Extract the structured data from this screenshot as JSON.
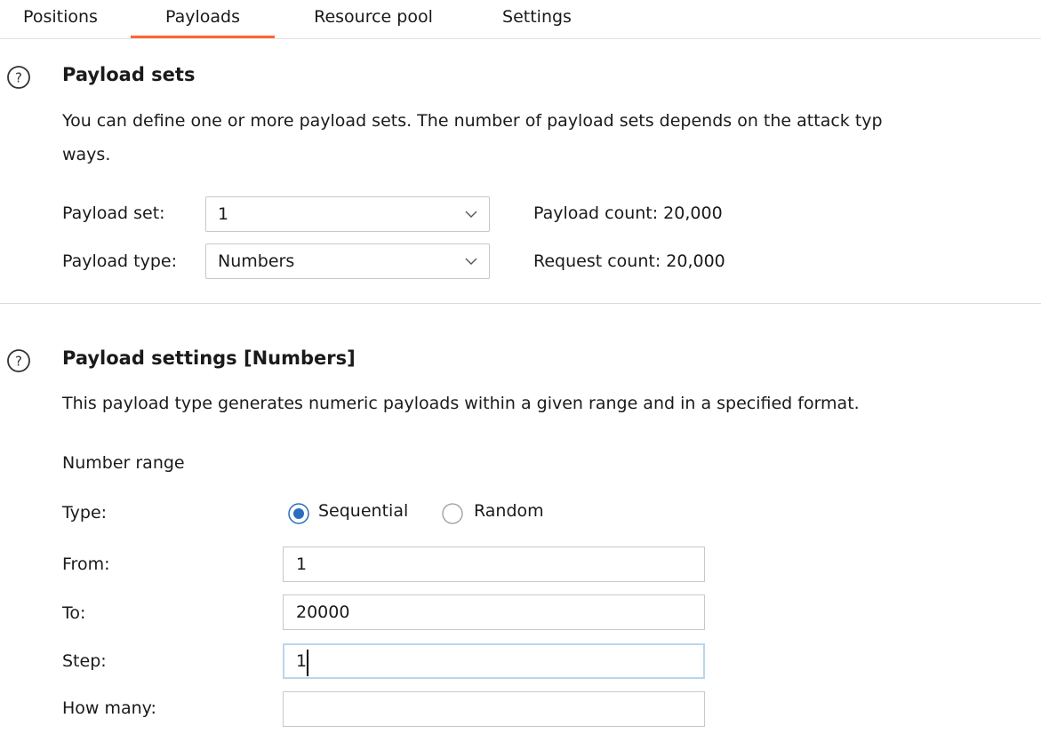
{
  "tabs": [
    {
      "label": "Positions"
    },
    {
      "label": "Payloads"
    },
    {
      "label": "Resource pool"
    },
    {
      "label": "Settings"
    }
  ],
  "active_tab": "Payloads",
  "accent_color": "#ff6633",
  "payload_sets": {
    "title": "Payload sets",
    "description_line1": "You can define one or more payload sets. The number of payload sets depends on the attack typ",
    "description_line2": "ways.",
    "set_label": "Payload set:",
    "set_value": "1",
    "type_label": "Payload type:",
    "type_value": "Numbers",
    "payload_count": "Payload count: 20,000",
    "request_count": "Request count: 20,000"
  },
  "payload_settings": {
    "title": "Payload settings [Numbers]",
    "description": "This payload type generates numeric payloads within a given range and in a specified format.",
    "number_range_heading": "Number range",
    "type_label": "Type:",
    "type_options": [
      {
        "label": "Sequential",
        "selected": true
      },
      {
        "label": "Random",
        "selected": false
      }
    ],
    "from_label": "From:",
    "from_value": "1",
    "to_label": "To:",
    "to_value": "20000",
    "step_label": "Step:",
    "step_value": "1",
    "how_many_label": "How many:",
    "how_many_value": ""
  },
  "icons": {
    "help": "help-circle-icon",
    "dropdown": "chevron-down-icon"
  }
}
